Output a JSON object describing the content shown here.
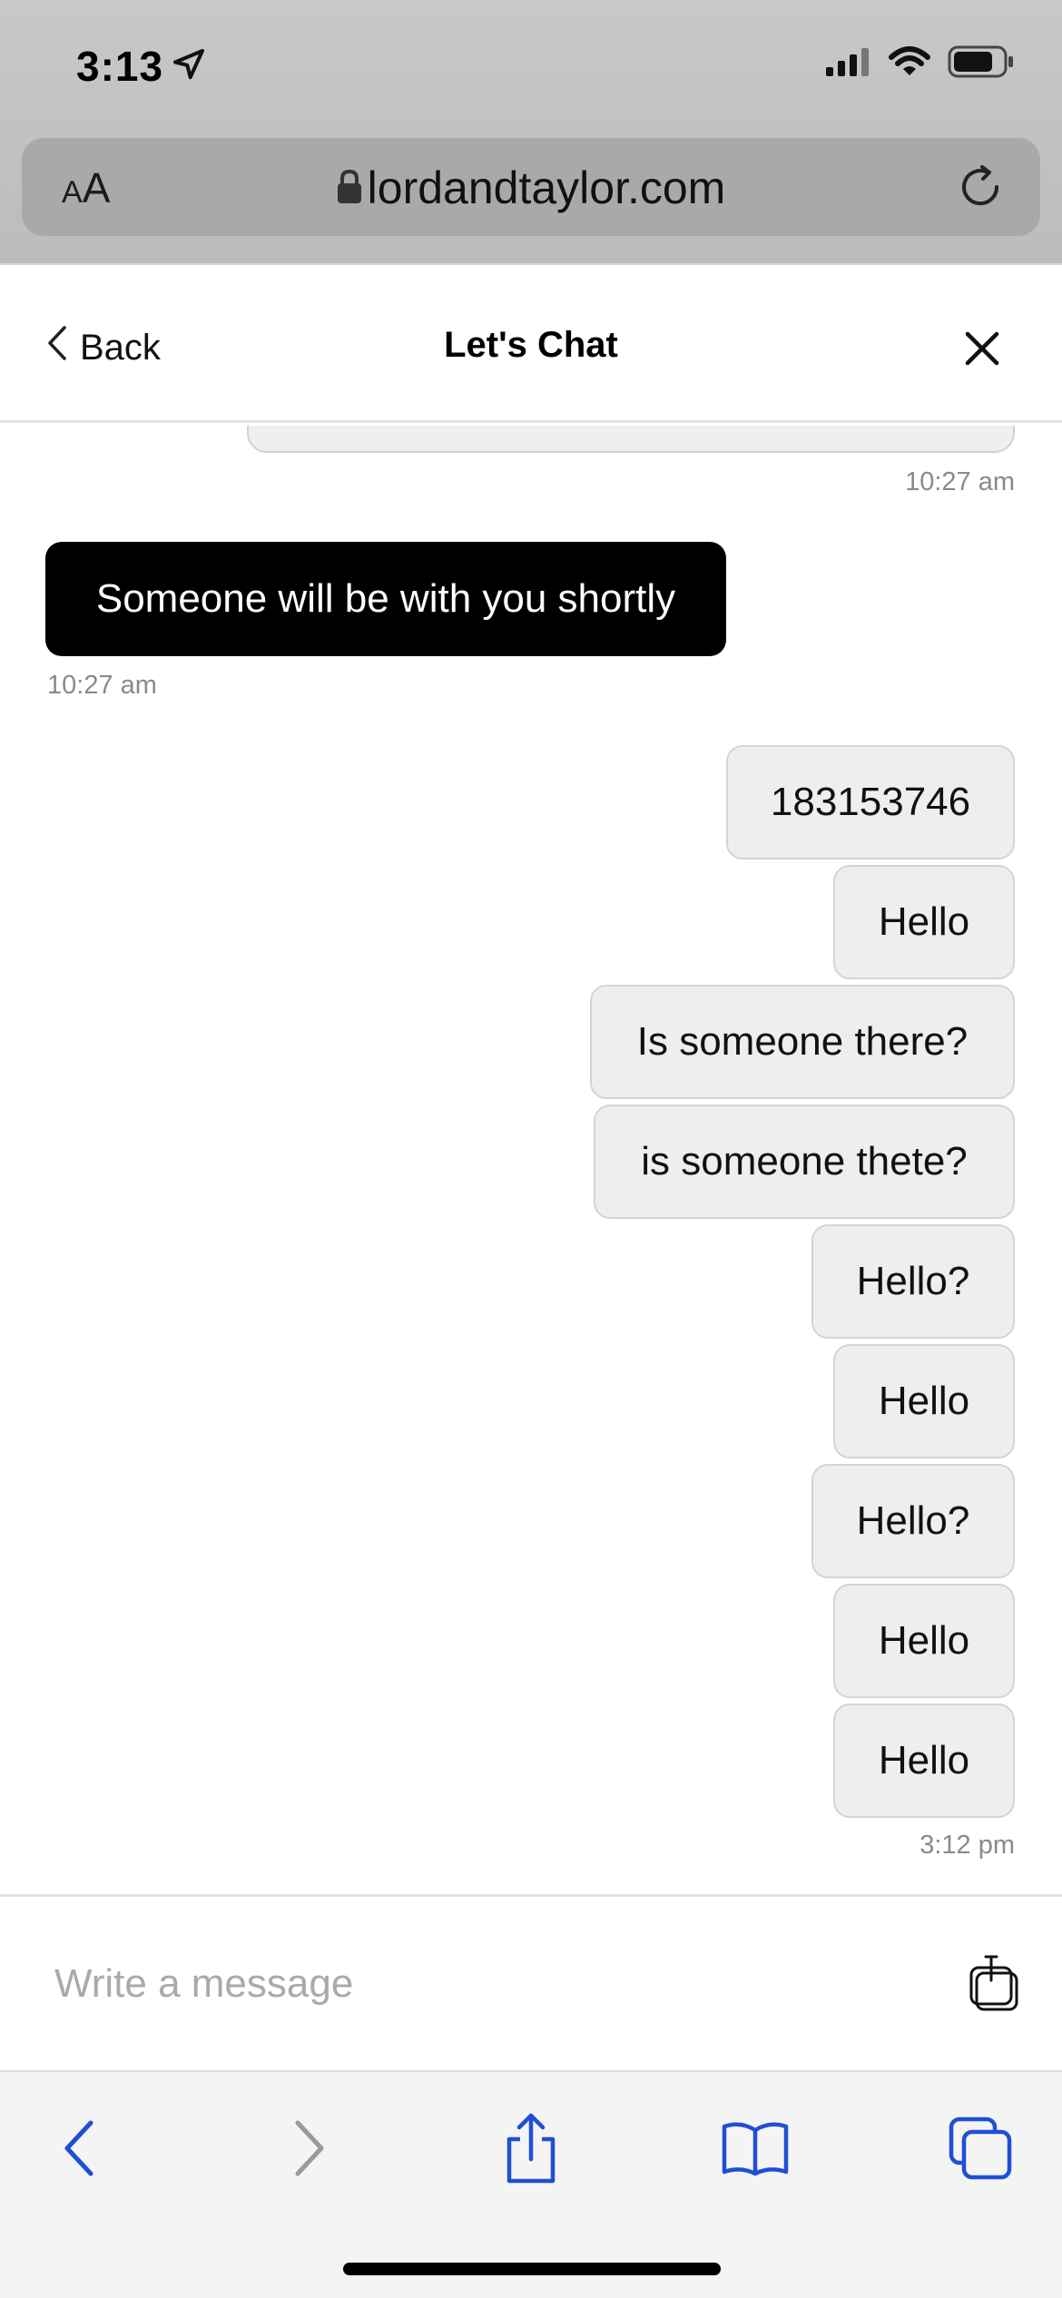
{
  "status_bar": {
    "time": "3:13"
  },
  "browser": {
    "text_size_label_small": "A",
    "text_size_label_large": "A",
    "url": "lordandtaylor.com"
  },
  "chat_header": {
    "back_label": "Back",
    "title": "Let's Chat"
  },
  "messages": {
    "previous_timestamp": "10:27 am",
    "agent": {
      "text": "Someone will be with you shortly",
      "timestamp": "10:27 am"
    },
    "user": [
      {
        "text": "183153746"
      },
      {
        "text": "Hello"
      },
      {
        "text": "Is someone there?"
      },
      {
        "text": "is someone thete?"
      },
      {
        "text": "Hello?"
      },
      {
        "text": "Hello"
      },
      {
        "text": "Hello?"
      },
      {
        "text": "Hello"
      },
      {
        "text": "Hello"
      }
    ],
    "user_timestamp": "3:12 pm"
  },
  "composer": {
    "placeholder": "Write a message",
    "value": ""
  },
  "colors": {
    "agent_bubble": "#000000",
    "user_bubble": "#eeeeee",
    "toolbar_accent": "#1f4fd6"
  },
  "icons": {
    "location": "location-arrow-icon",
    "signal": "cellular-signal-icon",
    "wifi": "wifi-icon",
    "battery": "battery-icon",
    "lock": "lock-icon",
    "reload": "reload-icon",
    "back": "chevron-left-icon",
    "close": "close-icon",
    "attach": "attachment-icon",
    "nav_back": "nav-back-icon",
    "nav_forward": "nav-forward-icon",
    "share": "share-icon",
    "bookmarks": "bookmarks-icon",
    "tabs": "tabs-icon"
  }
}
